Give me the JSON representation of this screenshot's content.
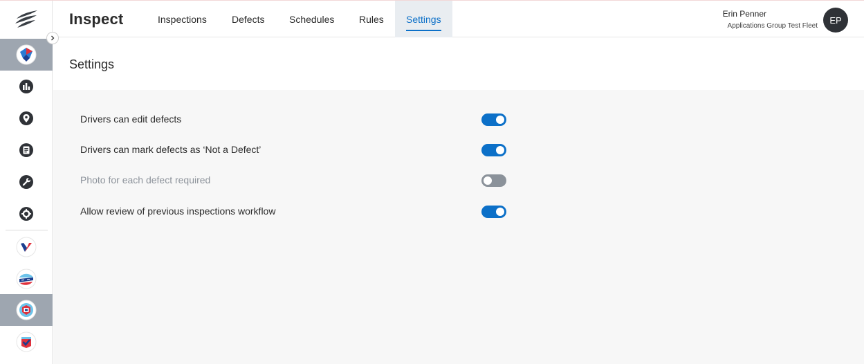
{
  "app": {
    "title": "Inspect"
  },
  "nav": {
    "tabs": [
      {
        "label": "Inspections",
        "active": false
      },
      {
        "label": "Defects",
        "active": false
      },
      {
        "label": "Schedules",
        "active": false
      },
      {
        "label": "Rules",
        "active": false
      },
      {
        "label": "Settings",
        "active": true
      }
    ]
  },
  "user": {
    "name": "Erin Penner",
    "org": "Applications Group Test Fleet",
    "initials": "EP"
  },
  "sidebar": {
    "items": [
      {
        "icon": "inspect-app-icon",
        "active": true
      },
      {
        "icon": "bar-chart-icon",
        "active": false
      },
      {
        "icon": "location-pin-icon",
        "active": false
      },
      {
        "icon": "document-icon",
        "active": false
      },
      {
        "icon": "wrench-icon",
        "active": false
      },
      {
        "icon": "gear-icon",
        "active": false
      },
      {
        "icon": "app-v-icon",
        "active": false
      },
      {
        "icon": "app-road-icon",
        "active": false
      },
      {
        "icon": "app-shield-icon",
        "active": true
      },
      {
        "icon": "app-check-icon",
        "active": false
      }
    ]
  },
  "page": {
    "title": "Settings"
  },
  "settings": [
    {
      "label": "Drivers can edit defects",
      "enabled": true,
      "disabled": false
    },
    {
      "label": "Drivers can mark defects as ‘Not a Defect’",
      "enabled": true,
      "disabled": false
    },
    {
      "label": "Photo for each defect required",
      "enabled": false,
      "disabled": true
    },
    {
      "label": "Allow review of previous inspections workflow",
      "enabled": true,
      "disabled": false
    }
  ],
  "colors": {
    "accent": "#0c70c8",
    "rail_active": "#9ea6b0",
    "toggle_off": "#8b929a",
    "avatar": "#2f3237"
  }
}
